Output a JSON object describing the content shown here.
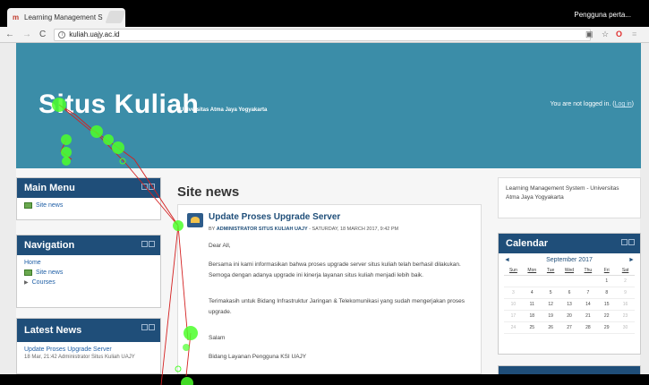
{
  "browser": {
    "tab_title": "Learning Management S",
    "tab_close": "×",
    "user_label": "Pengguna perta...",
    "url": "kuliah.uajy.ac.id",
    "nav": {
      "back": "←",
      "forward": "→",
      "reload": "C",
      "info": "i"
    },
    "ext": {
      "translate": "▣",
      "star": "☆",
      "opera": "O",
      "menu": "≡"
    }
  },
  "header": {
    "title": "Situs Kuliah",
    "subtitle": "Universitas Atma Jaya Yogyakarta",
    "login_text": "You are not logged in. (",
    "login_link": "Log in",
    "login_close": ")"
  },
  "main_menu": {
    "title": "Main Menu",
    "items": [
      {
        "label": "Site news"
      }
    ]
  },
  "navigation": {
    "title": "Navigation",
    "home": "Home",
    "site_news": "Site news",
    "courses": "Courses"
  },
  "latest_news": {
    "title": "Latest News",
    "item_title": "Update Proses Upgrade Server",
    "item_meta": "18 Mar, 21:42 Administrator Situs Kuliah UAJY"
  },
  "main": {
    "heading": "Site news",
    "post": {
      "title": "Update Proses Upgrade Server",
      "meta_by": "BY ",
      "meta_author": "ADMINISTRATOR SITUS KULIAH UAJY",
      "meta_date": " - SATURDAY, 18 MARCH 2017, 9:42 PM",
      "greeting": "Dear All,",
      "para1": "Bersama ini kami informasikan bahwa proses upgrade server situs kuliah telah berhasil dilakukan. Semoga dengan adanya upgrade ini kinerja layanan situs kuliah menjadi lebih baik.",
      "para2": "Terimakasih untuk Bidang Infrastruktur Jaringan & Telekomunikasi yang sudah mengerjakan proses upgrade.",
      "closing": "Salam",
      "signature": "Bidang Layanan Pengguna KSI UAJY"
    }
  },
  "info_box": {
    "text": "Learning Management System - Universitas Atma Jaya Yogyakarta"
  },
  "calendar": {
    "title": "Calendar",
    "month": "September 2017",
    "prev": "◄",
    "next": "►",
    "dow": [
      "Sun",
      "Mon",
      "Tue",
      "Wed",
      "Thu",
      "Fri",
      "Sat"
    ],
    "weeks": [
      [
        "",
        "",
        "",
        "",
        "",
        "1",
        "2"
      ],
      [
        "3",
        "4",
        "5",
        "6",
        "7",
        "8",
        "9"
      ],
      [
        "10",
        "11",
        "12",
        "13",
        "14",
        "15",
        "16"
      ],
      [
        "17",
        "18",
        "19",
        "20",
        "21",
        "22",
        "23"
      ],
      [
        "24",
        "25",
        "26",
        "27",
        "28",
        "29",
        "30"
      ]
    ]
  },
  "colors": {
    "header_bg": "#3b8da8",
    "block_head": "#1f4e79",
    "gaze_fixation": "#4cff2a",
    "gaze_path": "#d42020"
  }
}
